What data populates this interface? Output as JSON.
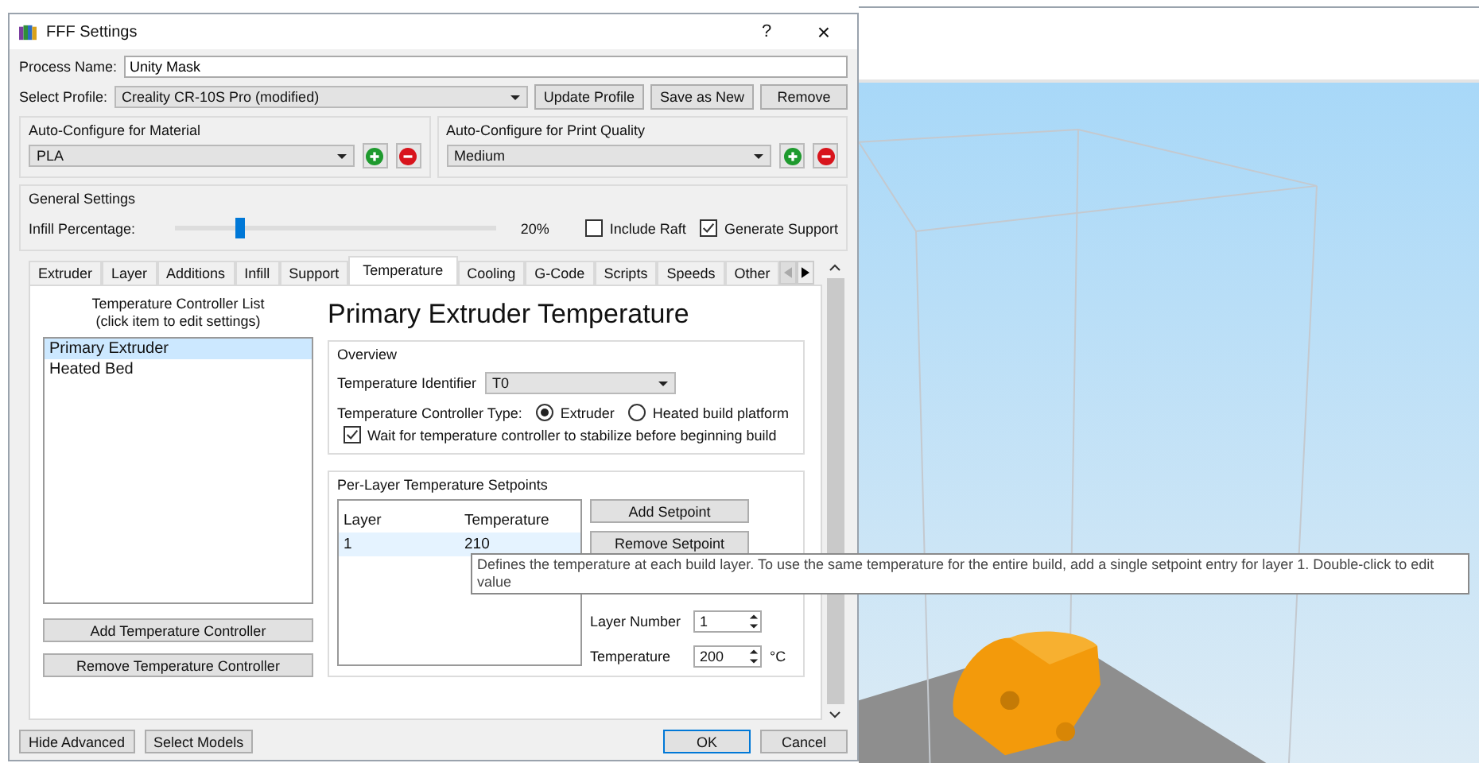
{
  "window": {
    "title": "FFF Settings",
    "help": "?",
    "close": "×"
  },
  "process_name": {
    "label": "Process Name:",
    "value": "Unity Mask"
  },
  "profile": {
    "label": "Select Profile:",
    "value": "Creality CR-10S Pro (modified)",
    "buttons": [
      "Update Profile",
      "Save as New",
      "Remove"
    ]
  },
  "material": {
    "title": "Auto-Configure for Material",
    "value": "PLA"
  },
  "quality": {
    "title": "Auto-Configure for Print Quality",
    "value": "Medium"
  },
  "general": {
    "title": "General Settings",
    "infill_label": "Infill Percentage:",
    "level": 0.2,
    "infill_reading": "20%",
    "options": [
      {
        "label": "Include Raft",
        "checked": false
      },
      {
        "label": "Generate Support",
        "checked": true
      }
    ]
  },
  "tabs": [
    {
      "label": "Extruder",
      "selected": false
    },
    {
      "label": "Layer",
      "selected": false
    },
    {
      "label": "Additions",
      "selected": false
    },
    {
      "label": "Infill",
      "selected": false
    },
    {
      "label": "Support",
      "selected": false
    },
    {
      "label": "Temperature",
      "selected": true
    },
    {
      "label": "Cooling",
      "selected": false
    },
    {
      "label": "G-Code",
      "selected": false
    },
    {
      "label": "Scripts",
      "selected": false
    },
    {
      "label": "Speeds",
      "selected": false
    },
    {
      "label": "Other",
      "selected": false
    }
  ],
  "controller_list": {
    "title": "Temperature Controller List",
    "hint": "(click item to edit settings)",
    "items": [
      {
        "label": "Primary Extruder",
        "selected": true
      },
      {
        "label": "Heated Bed",
        "selected": false
      }
    ],
    "buttons": [
      "Add Temperature Controller",
      "Remove Temperature Controller"
    ]
  },
  "heading": "Primary Extruder Temperature",
  "overview": {
    "title": "Overview",
    "identifier_label": "Temperature Identifier",
    "identifier": "T0",
    "type_label": "Temperature Controller Type:",
    "types": [
      {
        "label": "Extruder",
        "selected": true
      },
      {
        "label": "Heated build platform",
        "selected": false
      }
    ],
    "wait": {
      "label": "Wait for temperature controller to stabilize before beginning build",
      "checked": true
    }
  },
  "setpoints": {
    "title": "Per-Layer Temperature Setpoints",
    "columns": [
      "Layer",
      "Temperature"
    ],
    "rows": [
      {
        "cells": [
          "1",
          "210"
        ],
        "selected": true
      }
    ],
    "buttons": [
      "Add Setpoint",
      "Remove Setpoint"
    ],
    "layer_label": "Layer Number",
    "layer_value": "1",
    "temp_label": "Temperature",
    "temp_value": "200",
    "unit": "°C"
  },
  "tooltip": "Defines the temperature at each build layer.  To use the same temperature for the entire build, add a single setpoint entry for layer 1.  Double-click to edit value",
  "footer": {
    "left": [
      "Hide Advanced",
      "Select Models"
    ],
    "right": [
      "OK",
      "Cancel"
    ]
  }
}
